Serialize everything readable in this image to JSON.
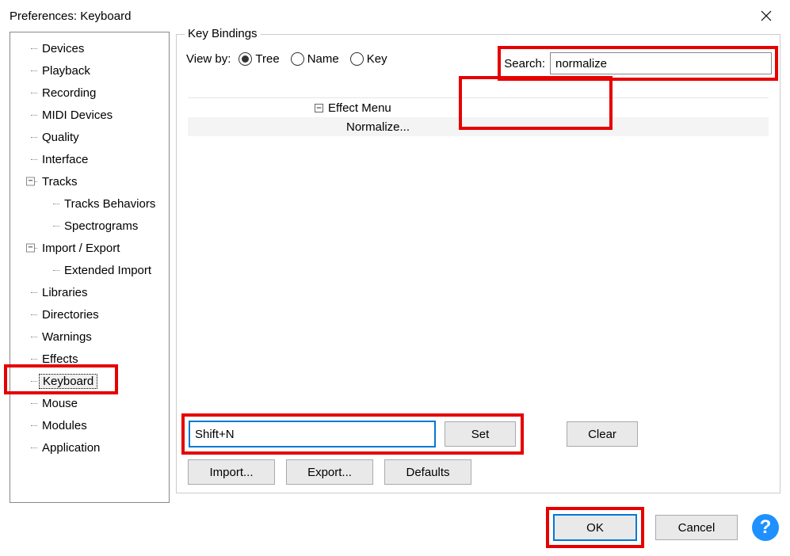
{
  "title": "Preferences: Keyboard",
  "sidebar": {
    "items": [
      {
        "label": "Devices"
      },
      {
        "label": "Playback"
      },
      {
        "label": "Recording"
      },
      {
        "label": "MIDI Devices"
      },
      {
        "label": "Quality"
      },
      {
        "label": "Interface"
      },
      {
        "label": "Tracks",
        "expandable": true
      },
      {
        "label": "Tracks Behaviors",
        "child": true
      },
      {
        "label": "Spectrograms",
        "child": true
      },
      {
        "label": "Import / Export",
        "expandable": true
      },
      {
        "label": "Extended Import",
        "child": true
      },
      {
        "label": "Libraries"
      },
      {
        "label": "Directories"
      },
      {
        "label": "Warnings"
      },
      {
        "label": "Effects"
      },
      {
        "label": "Keyboard",
        "selected": true
      },
      {
        "label": "Mouse"
      },
      {
        "label": "Modules"
      },
      {
        "label": "Application"
      }
    ]
  },
  "group": {
    "title": "Key Bindings"
  },
  "viewby": {
    "label": "View by:",
    "options": [
      "Tree",
      "Name",
      "Key"
    ],
    "selected": "Tree"
  },
  "search": {
    "label": "Search:",
    "value": "normalize"
  },
  "results": {
    "parent": "Effect Menu",
    "child": "Normalize..."
  },
  "shortcut": {
    "value": "Shift+N"
  },
  "buttons": {
    "set": "Set",
    "clear": "Clear",
    "import": "Import...",
    "export": "Export...",
    "defaults": "Defaults",
    "ok": "OK",
    "cancel": "Cancel"
  },
  "expander_minus": "−",
  "help_glyph": "?"
}
